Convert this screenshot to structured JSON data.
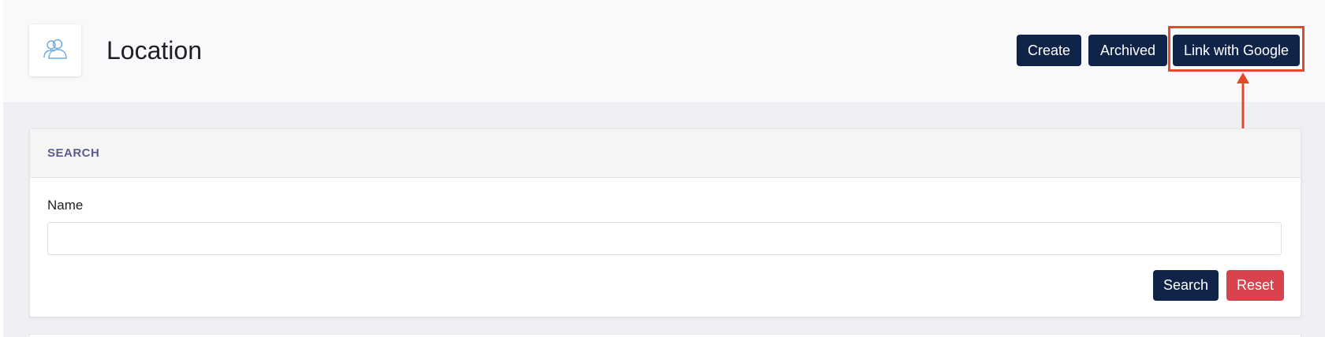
{
  "header": {
    "title": "Location",
    "icon": "users-icon",
    "buttons": {
      "create": "Create",
      "archived": "Archived",
      "link_google": "Link with Google"
    }
  },
  "annotation": {
    "highlight_color": "#e24a2e",
    "target": "Link with Google"
  },
  "search_panel": {
    "heading": "SEARCH",
    "fields": {
      "name_label": "Name",
      "name_value": "",
      "name_placeholder": ""
    },
    "buttons": {
      "search": "Search",
      "reset": "Reset"
    }
  },
  "colors": {
    "primary": "#102348",
    "danger": "#d9434e",
    "heading_accent": "#5a5d8f"
  }
}
